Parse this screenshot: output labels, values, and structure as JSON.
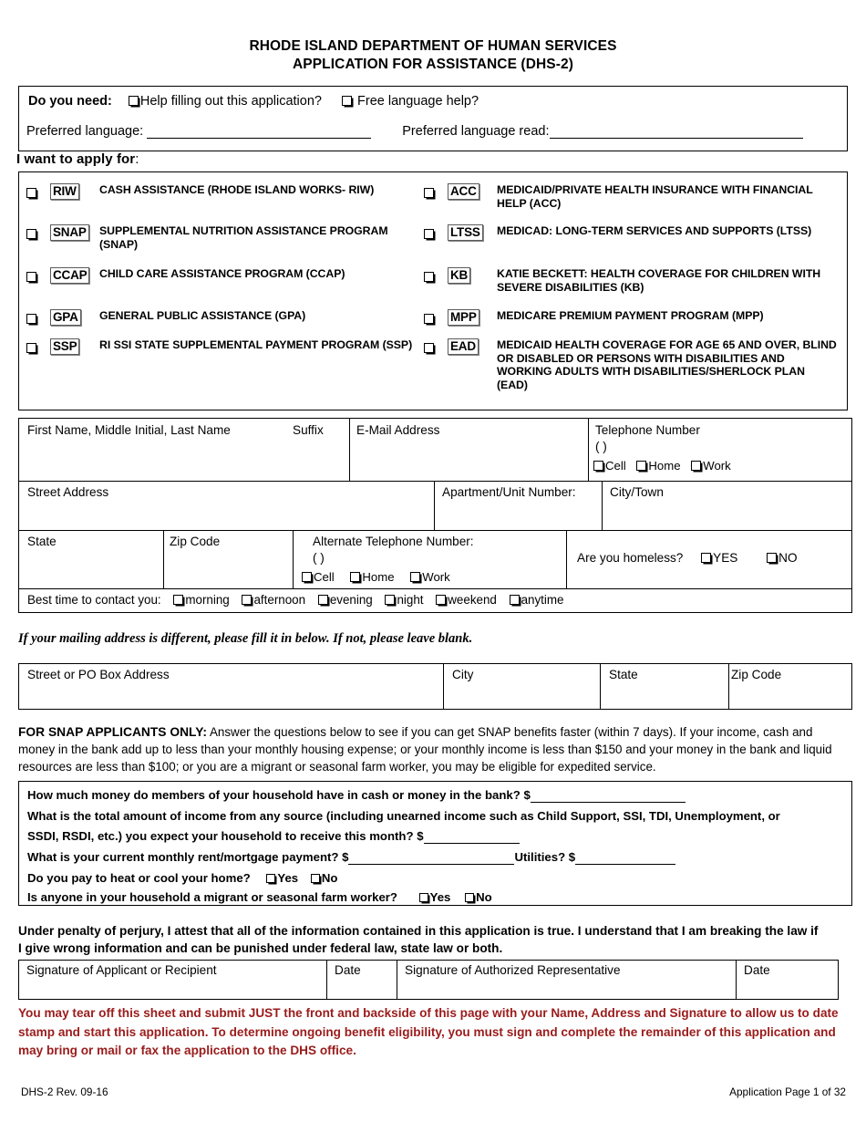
{
  "header": {
    "line1": "RHODE ISLAND DEPARTMENT OF HUMAN SERVICES",
    "line2": "APPLICATION FOR ASSISTANCE (DHS-2)"
  },
  "need_box": {
    "prompt": "Do you need:",
    "option_help": "Help filling out this application?",
    "option_language": "Free language help?",
    "preferred_language_label": "Preferred language:",
    "preferred_language_read_label": "Preferred language read:"
  },
  "apply_section": {
    "heading_bold": "I want to apply for",
    "heading_rest": ":",
    "left_programs": [
      {
        "code": "RIW",
        "desc": "CASH ASSISTANCE (RHODE ISLAND WORKS- RIW)"
      },
      {
        "code": "SNAP",
        "desc": "SUPPLEMENTAL NUTRITION ASSISTANCE PROGRAM (SNAP)"
      },
      {
        "code": "CCAP",
        "desc": "CHILD CARE ASSISTANCE PROGRAM (CCAP)"
      },
      {
        "code": "GPA",
        "desc": "GENERAL PUBLIC ASSISTANCE (GPA)"
      },
      {
        "code": "SSP",
        "desc": "RI SSI STATE SUPPLEMENTAL PAYMENT PROGRAM (SSP)"
      }
    ],
    "right_programs": [
      {
        "code": "ACC",
        "desc": "MEDICAID/PRIVATE HEALTH INSURANCE WITH FINANCIAL HELP (ACC)"
      },
      {
        "code": "LTSS",
        "desc": "MEDICAD: LONG-TERM SERVICES AND SUPPORTS (LTSS)"
      },
      {
        "code": "KB",
        "desc": "KATIE BECKETT: HEALTH COVERAGE FOR CHILDREN WITH SEVERE DISABILITIES (KB)"
      },
      {
        "code": "MPP",
        "desc": "MEDICARE PREMIUM PAYMENT PROGRAM (MPP)"
      },
      {
        "code": "EAD",
        "desc": "MEDICAID HEALTH COVERAGE FOR AGE 65 AND OVER, BLIND OR DISABLED OR  PERSONS WITH DISABILITIES AND WORKING ADULTS WITH DISABILITIES/SHERLOCK PLAN (EAD)"
      }
    ]
  },
  "contact": {
    "name_label": "First Name, Middle Initial, Last Name",
    "suffix_label": "Suffix",
    "email_label": "E-Mail Address",
    "telephone_label": "Telephone Number",
    "paren": "(            )",
    "phone_types": [
      "Cell",
      "Home",
      "Work"
    ],
    "street_label": "Street Address",
    "apartment_label": "Apartment/Unit Number:",
    "city_label": "City/Town",
    "state_label": "State",
    "zip_label": "Zip Code",
    "alt_phone_label": "Alternate Telephone Number:",
    "homeless_question": "Are you homeless?",
    "homeless_yes": "YES",
    "homeless_no": "NO",
    "best_time_label": "Best time to contact you:",
    "best_times": [
      "morning",
      "afternoon",
      "evening",
      "night",
      "weekend",
      "anytime"
    ]
  },
  "mailing": {
    "note": "If your mailing address is different, please fill it in below. If not, please leave blank.",
    "street_label": "Street or PO Box Address",
    "city_label": "City",
    "state_label": "State",
    "zip_label": "Zip Code"
  },
  "snap": {
    "intro_bold": "FOR SNAP APPLICANTS ONLY:",
    "intro_text": "  Answer the questions below to see if you can get SNAP benefits faster (within 7 days). If your income, cash and money in the bank add up to less than your monthly  housing expense; or your monthly income is less than $150 and your money in the bank and liquid resources are less than $100; or you are a migrant or seasonal farm worker, you may be eligible for expedited service.",
    "q1": "How much money do members of your household have in cash or money in the bank?  $",
    "q2_a": "What is the total amount of income from any source (including unearned income such as Child Support, SSI, TDI, Unemployment, or",
    "q2_b": "SSDI, RSDI, etc.) you expect your household to receive this month?  $",
    "q3_a": "What is your current monthly rent/mortgage payment? $",
    "q3_b": "Utilities?  $",
    "q4": "Do you pay to heat or cool your home?",
    "q4_yes": "Yes",
    "q4_no": "No",
    "q5": "Is anyone in your household a migrant or seasonal farm worker?",
    "q5_yes": "Yes",
    "q5_no": "No"
  },
  "attestation": {
    "text": "Under penalty of perjury, I attest that all of the information contained in this application is true. I understand that I am  breaking the law if I give wrong information and can be punished under federal law, state law or both.",
    "sig_applicant_label": "Signature of Applicant or Recipient",
    "date_label_1": "Date",
    "sig_rep_label": "Signature of Authorized Representative",
    "date_label_2": "Date"
  },
  "red_notice": {
    "text": "You may tear off this sheet and submit JUST the front and backside of this page with your Name, Address and Signature to allow us to date stamp and start this application. To determine ongoing benefit eligibility, you must sign and complete the remainder of this application and may bring or mail or fax the application to the DHS office.",
    "color": "#9B1B1B"
  },
  "footer": {
    "left": "DHS-2 Rev. 09-16",
    "right": "Application Page 1 of 32"
  }
}
